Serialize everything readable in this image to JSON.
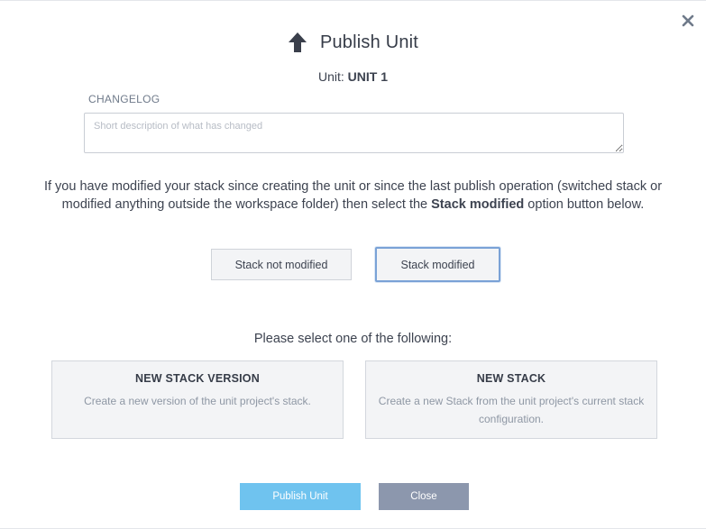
{
  "dialog": {
    "title": "Publish Unit",
    "title_icon": "up-arrow-icon",
    "close_icon": "close-icon",
    "unit_label": "Unit: ",
    "unit_name": "UNIT 1"
  },
  "changelog": {
    "label": "CHANGELOG",
    "placeholder": "Short description of what has changed",
    "value": ""
  },
  "info": {
    "text_before": "If you have modified your stack since creating the unit or since the last publish operation (switched stack or modified anything outside the workspace folder) then select the ",
    "text_bold": "Stack modified",
    "text_after": " option button below."
  },
  "stack_options": {
    "not_modified_label": "Stack not modified",
    "modified_label": "Stack modified",
    "selected": "Stack modified"
  },
  "select_prompt": "Please select one of the following:",
  "cards": [
    {
      "title": "NEW STACK VERSION",
      "description": "Create a new version of the unit project's stack."
    },
    {
      "title": "NEW STACK",
      "description": "Create a new Stack from the unit project's current stack configuration."
    }
  ],
  "actions": {
    "publish_label": "Publish Unit",
    "close_label": "Close"
  },
  "colors": {
    "publish_button": "#6fc3ef",
    "close_button": "#8c97ad",
    "selected_border": "#7aa2d6",
    "card_background": "#f3f4f6"
  }
}
